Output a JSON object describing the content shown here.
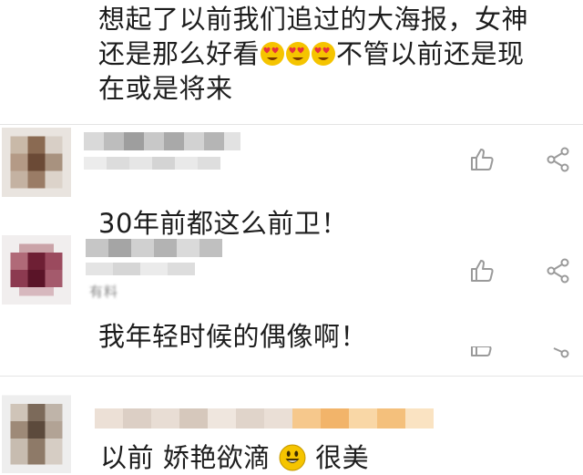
{
  "comments": [
    {
      "lines": [
        "想起了以前我们追过的大海报，女神",
        "还是那么好看",
        "不管以前还是现",
        "在或是将来"
      ],
      "emoji_icons": [
        "heart-eyes-emoji-icon",
        "heart-eyes-emoji-icon",
        "heart-eyes-emoji-icon"
      ]
    },
    {
      "text": "30年前都这么前卫！"
    },
    {
      "text": "我年轻时候的偶像啊！"
    },
    {
      "text_before": "以前 娇艳欲滴",
      "emoji_icon": "grinning-emoji-icon",
      "text_after": "很美"
    }
  ],
  "faded_label": "有料",
  "icons": {
    "like": "thumbs-up-icon",
    "share": "share-icon"
  },
  "colors": {
    "text": "#1d1d1d",
    "icon": "#9a9a9a",
    "divider": "#e4e4e4",
    "emoji_yellow": "#f5c400",
    "emoji_heart": "#e8323c"
  }
}
